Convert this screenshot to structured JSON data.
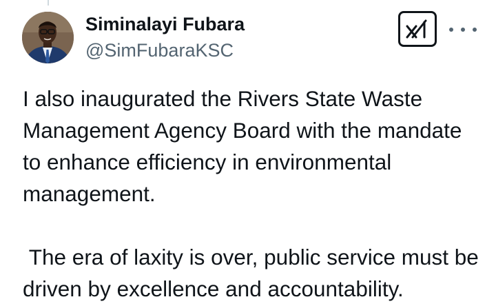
{
  "tweet": {
    "author": {
      "display_name": "Siminalayi Fubara",
      "handle": "@SimFubaraKSC",
      "avatar_icon": "profile-photo"
    },
    "actions": {
      "grok_icon": "grok-icon",
      "more_icon": "more-icon"
    },
    "text": {
      "paragraph_1": "I also inaugurated the Rivers State Waste Management Agency Board with the mandate to enhance efficiency in environmental management.",
      "paragraph_2": " The era of laxity is over, public service must be driven by excellence and accountability."
    }
  }
}
